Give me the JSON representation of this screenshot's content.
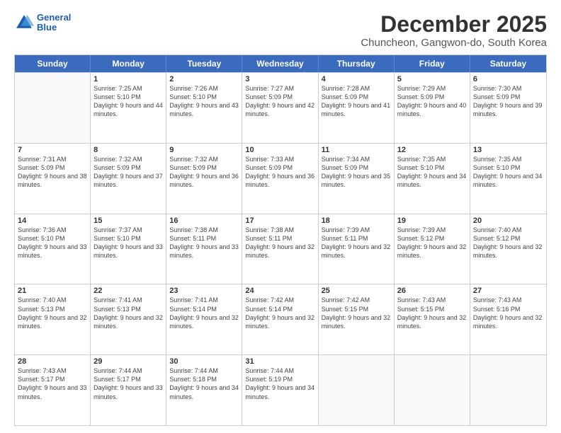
{
  "logo": {
    "line1": "General",
    "line2": "Blue"
  },
  "title": "December 2025",
  "subtitle": "Chuncheon, Gangwon-do, South Korea",
  "header_days": [
    "Sunday",
    "Monday",
    "Tuesday",
    "Wednesday",
    "Thursday",
    "Friday",
    "Saturday"
  ],
  "weeks": [
    [
      {
        "day": "",
        "sunrise": "",
        "sunset": "",
        "daylight": ""
      },
      {
        "day": "1",
        "sunrise": "Sunrise: 7:25 AM",
        "sunset": "Sunset: 5:10 PM",
        "daylight": "Daylight: 9 hours and 44 minutes."
      },
      {
        "day": "2",
        "sunrise": "Sunrise: 7:26 AM",
        "sunset": "Sunset: 5:10 PM",
        "daylight": "Daylight: 9 hours and 43 minutes."
      },
      {
        "day": "3",
        "sunrise": "Sunrise: 7:27 AM",
        "sunset": "Sunset: 5:09 PM",
        "daylight": "Daylight: 9 hours and 42 minutes."
      },
      {
        "day": "4",
        "sunrise": "Sunrise: 7:28 AM",
        "sunset": "Sunset: 5:09 PM",
        "daylight": "Daylight: 9 hours and 41 minutes."
      },
      {
        "day": "5",
        "sunrise": "Sunrise: 7:29 AM",
        "sunset": "Sunset: 5:09 PM",
        "daylight": "Daylight: 9 hours and 40 minutes."
      },
      {
        "day": "6",
        "sunrise": "Sunrise: 7:30 AM",
        "sunset": "Sunset: 5:09 PM",
        "daylight": "Daylight: 9 hours and 39 minutes."
      }
    ],
    [
      {
        "day": "7",
        "sunrise": "Sunrise: 7:31 AM",
        "sunset": "Sunset: 5:09 PM",
        "daylight": "Daylight: 9 hours and 38 minutes."
      },
      {
        "day": "8",
        "sunrise": "Sunrise: 7:32 AM",
        "sunset": "Sunset: 5:09 PM",
        "daylight": "Daylight: 9 hours and 37 minutes."
      },
      {
        "day": "9",
        "sunrise": "Sunrise: 7:32 AM",
        "sunset": "Sunset: 5:09 PM",
        "daylight": "Daylight: 9 hours and 36 minutes."
      },
      {
        "day": "10",
        "sunrise": "Sunrise: 7:33 AM",
        "sunset": "Sunset: 5:09 PM",
        "daylight": "Daylight: 9 hours and 36 minutes."
      },
      {
        "day": "11",
        "sunrise": "Sunrise: 7:34 AM",
        "sunset": "Sunset: 5:09 PM",
        "daylight": "Daylight: 9 hours and 35 minutes."
      },
      {
        "day": "12",
        "sunrise": "Sunrise: 7:35 AM",
        "sunset": "Sunset: 5:10 PM",
        "daylight": "Daylight: 9 hours and 34 minutes."
      },
      {
        "day": "13",
        "sunrise": "Sunrise: 7:35 AM",
        "sunset": "Sunset: 5:10 PM",
        "daylight": "Daylight: 9 hours and 34 minutes."
      }
    ],
    [
      {
        "day": "14",
        "sunrise": "Sunrise: 7:36 AM",
        "sunset": "Sunset: 5:10 PM",
        "daylight": "Daylight: 9 hours and 33 minutes."
      },
      {
        "day": "15",
        "sunrise": "Sunrise: 7:37 AM",
        "sunset": "Sunset: 5:10 PM",
        "daylight": "Daylight: 9 hours and 33 minutes."
      },
      {
        "day": "16",
        "sunrise": "Sunrise: 7:38 AM",
        "sunset": "Sunset: 5:11 PM",
        "daylight": "Daylight: 9 hours and 33 minutes."
      },
      {
        "day": "17",
        "sunrise": "Sunrise: 7:38 AM",
        "sunset": "Sunset: 5:11 PM",
        "daylight": "Daylight: 9 hours and 32 minutes."
      },
      {
        "day": "18",
        "sunrise": "Sunrise: 7:39 AM",
        "sunset": "Sunset: 5:11 PM",
        "daylight": "Daylight: 9 hours and 32 minutes."
      },
      {
        "day": "19",
        "sunrise": "Sunrise: 7:39 AM",
        "sunset": "Sunset: 5:12 PM",
        "daylight": "Daylight: 9 hours and 32 minutes."
      },
      {
        "day": "20",
        "sunrise": "Sunrise: 7:40 AM",
        "sunset": "Sunset: 5:12 PM",
        "daylight": "Daylight: 9 hours and 32 minutes."
      }
    ],
    [
      {
        "day": "21",
        "sunrise": "Sunrise: 7:40 AM",
        "sunset": "Sunset: 5:13 PM",
        "daylight": "Daylight: 9 hours and 32 minutes."
      },
      {
        "day": "22",
        "sunrise": "Sunrise: 7:41 AM",
        "sunset": "Sunset: 5:13 PM",
        "daylight": "Daylight: 9 hours and 32 minutes."
      },
      {
        "day": "23",
        "sunrise": "Sunrise: 7:41 AM",
        "sunset": "Sunset: 5:14 PM",
        "daylight": "Daylight: 9 hours and 32 minutes."
      },
      {
        "day": "24",
        "sunrise": "Sunrise: 7:42 AM",
        "sunset": "Sunset: 5:14 PM",
        "daylight": "Daylight: 9 hours and 32 minutes."
      },
      {
        "day": "25",
        "sunrise": "Sunrise: 7:42 AM",
        "sunset": "Sunset: 5:15 PM",
        "daylight": "Daylight: 9 hours and 32 minutes."
      },
      {
        "day": "26",
        "sunrise": "Sunrise: 7:43 AM",
        "sunset": "Sunset: 5:15 PM",
        "daylight": "Daylight: 9 hours and 32 minutes."
      },
      {
        "day": "27",
        "sunrise": "Sunrise: 7:43 AM",
        "sunset": "Sunset: 5:16 PM",
        "daylight": "Daylight: 9 hours and 32 minutes."
      }
    ],
    [
      {
        "day": "28",
        "sunrise": "Sunrise: 7:43 AM",
        "sunset": "Sunset: 5:17 PM",
        "daylight": "Daylight: 9 hours and 33 minutes."
      },
      {
        "day": "29",
        "sunrise": "Sunrise: 7:44 AM",
        "sunset": "Sunset: 5:17 PM",
        "daylight": "Daylight: 9 hours and 33 minutes."
      },
      {
        "day": "30",
        "sunrise": "Sunrise: 7:44 AM",
        "sunset": "Sunset: 5:18 PM",
        "daylight": "Daylight: 9 hours and 34 minutes."
      },
      {
        "day": "31",
        "sunrise": "Sunrise: 7:44 AM",
        "sunset": "Sunset: 5:19 PM",
        "daylight": "Daylight: 9 hours and 34 minutes."
      },
      {
        "day": "",
        "sunrise": "",
        "sunset": "",
        "daylight": ""
      },
      {
        "day": "",
        "sunrise": "",
        "sunset": "",
        "daylight": ""
      },
      {
        "day": "",
        "sunrise": "",
        "sunset": "",
        "daylight": ""
      }
    ]
  ]
}
